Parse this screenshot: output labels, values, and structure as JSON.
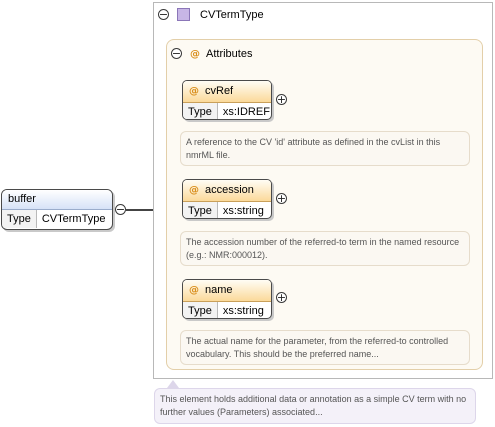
{
  "root_element": {
    "name": "buffer",
    "type_label": "Type",
    "type_value": "CVTermType"
  },
  "complex_type": {
    "name": "CVTermType"
  },
  "attributes_group": {
    "label": "Attributes"
  },
  "attributes": [
    {
      "name": "cvRef",
      "type_label": "Type",
      "type_value": "xs:IDREF",
      "doc": "A reference to the CV 'id' attribute as defined in the cvList in this nmrML file."
    },
    {
      "name": "accession",
      "type_label": "Type",
      "type_value": "xs:string",
      "doc": "The accession number of the referred-to term in the named resource (e.g.: NMR:000012)."
    },
    {
      "name": "name",
      "type_label": "Type",
      "type_value": "xs:string",
      "doc": "The actual name for the parameter, from the referred-to controlled vocabulary. This should be the preferred name..."
    }
  ],
  "type_doc": "This element holds additional data or annotation as a simple CV term with no further values (Parameters) associated...",
  "symbols": {
    "collapse": "−",
    "expand": "+",
    "attribute": "@"
  },
  "colors": {
    "element_header": "#d6e2f7",
    "attribute_header": "#fbd99a",
    "type_icon": "#c7b6e6",
    "group_border": "#e3cfa9"
  }
}
